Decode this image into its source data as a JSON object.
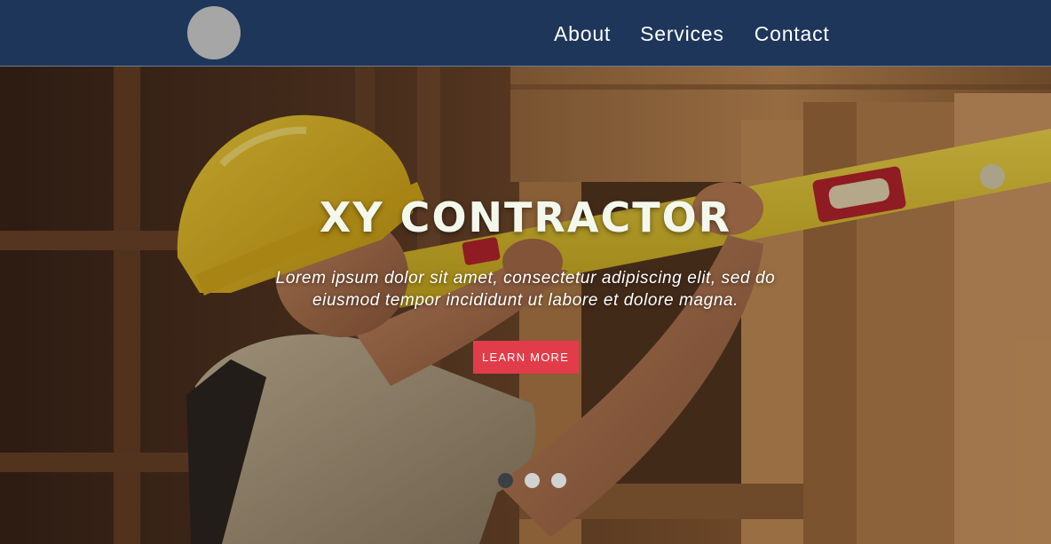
{
  "header": {
    "logo_icon": "circle-logo",
    "logo_color": "#a6a6a6",
    "background_color": "#1e365a",
    "nav": [
      {
        "label": "About"
      },
      {
        "label": "Services"
      },
      {
        "label": "Contact"
      }
    ]
  },
  "hero": {
    "background_image": "construction-worker-with-level-photo",
    "title": "XY CONTRACTOR",
    "subtitle": "Lorem ipsum dolor sit amet, consectetur adipiscing elit, sed do eiusmod tempor incididunt ut labore et dolore magna.",
    "cta_label": "LEARN MORE",
    "cta_color": "#e23c4b",
    "carousel": {
      "total_slides": 3,
      "active_index": 0
    }
  }
}
